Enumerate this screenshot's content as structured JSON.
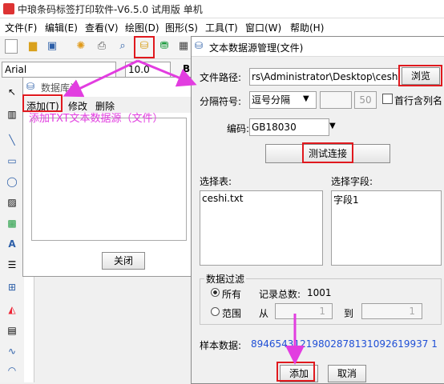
{
  "app": {
    "title": "中琅条码标签打印软件-V6.5.0 试用版 单机",
    "menu": [
      "文件(F)",
      "编辑(E)",
      "查看(V)",
      "绘图(D)",
      "图形(S)",
      "工具(T)",
      "窗口(W)",
      "帮助(H)"
    ],
    "font_name": "Arial",
    "font_size": "10.0",
    "bold_label": "B"
  },
  "db_dialog": {
    "title": "数据库设",
    "menu": {
      "add": "添加(T)",
      "edit": "修改",
      "delete": "删除"
    },
    "close_label": "关闭"
  },
  "annotation": "添加TXT文本数据源（文件）",
  "txt_dialog": {
    "title": "文本数据源管理(文件)",
    "file_path_label": "文件路径:",
    "file_path_value": "rs\\Administrator\\Desktop\\ceshi.txt",
    "browse_label": "浏览",
    "separator_label": "分隔符号:",
    "separator_value": "逗号分隔",
    "separator_num": "50",
    "first_row_label": "首行含列名",
    "encoding_label": "编码:",
    "encoding_value": "GB18030",
    "test_label": "测试连接",
    "table_label": "选择表:",
    "table_items": [
      "ceshi.txt"
    ],
    "field_label": "选择字段:",
    "field_items": [
      "字段1"
    ],
    "filter_label": "数据过滤",
    "all_label": "所有",
    "record_total_label": "记录总数:",
    "record_total": "1001",
    "range_label": "范围",
    "from_label": "从",
    "from_value": "1",
    "to_label": "到",
    "to_value": "1",
    "sample_label": "样本数据:",
    "sample_value": "89465431219802878131092619937 1",
    "add_label": "添加",
    "cancel_label": "取消"
  },
  "colors": {
    "highlight": "#e0191e",
    "arrow": "#e23de0",
    "sample_text": "#1f4fd6"
  }
}
